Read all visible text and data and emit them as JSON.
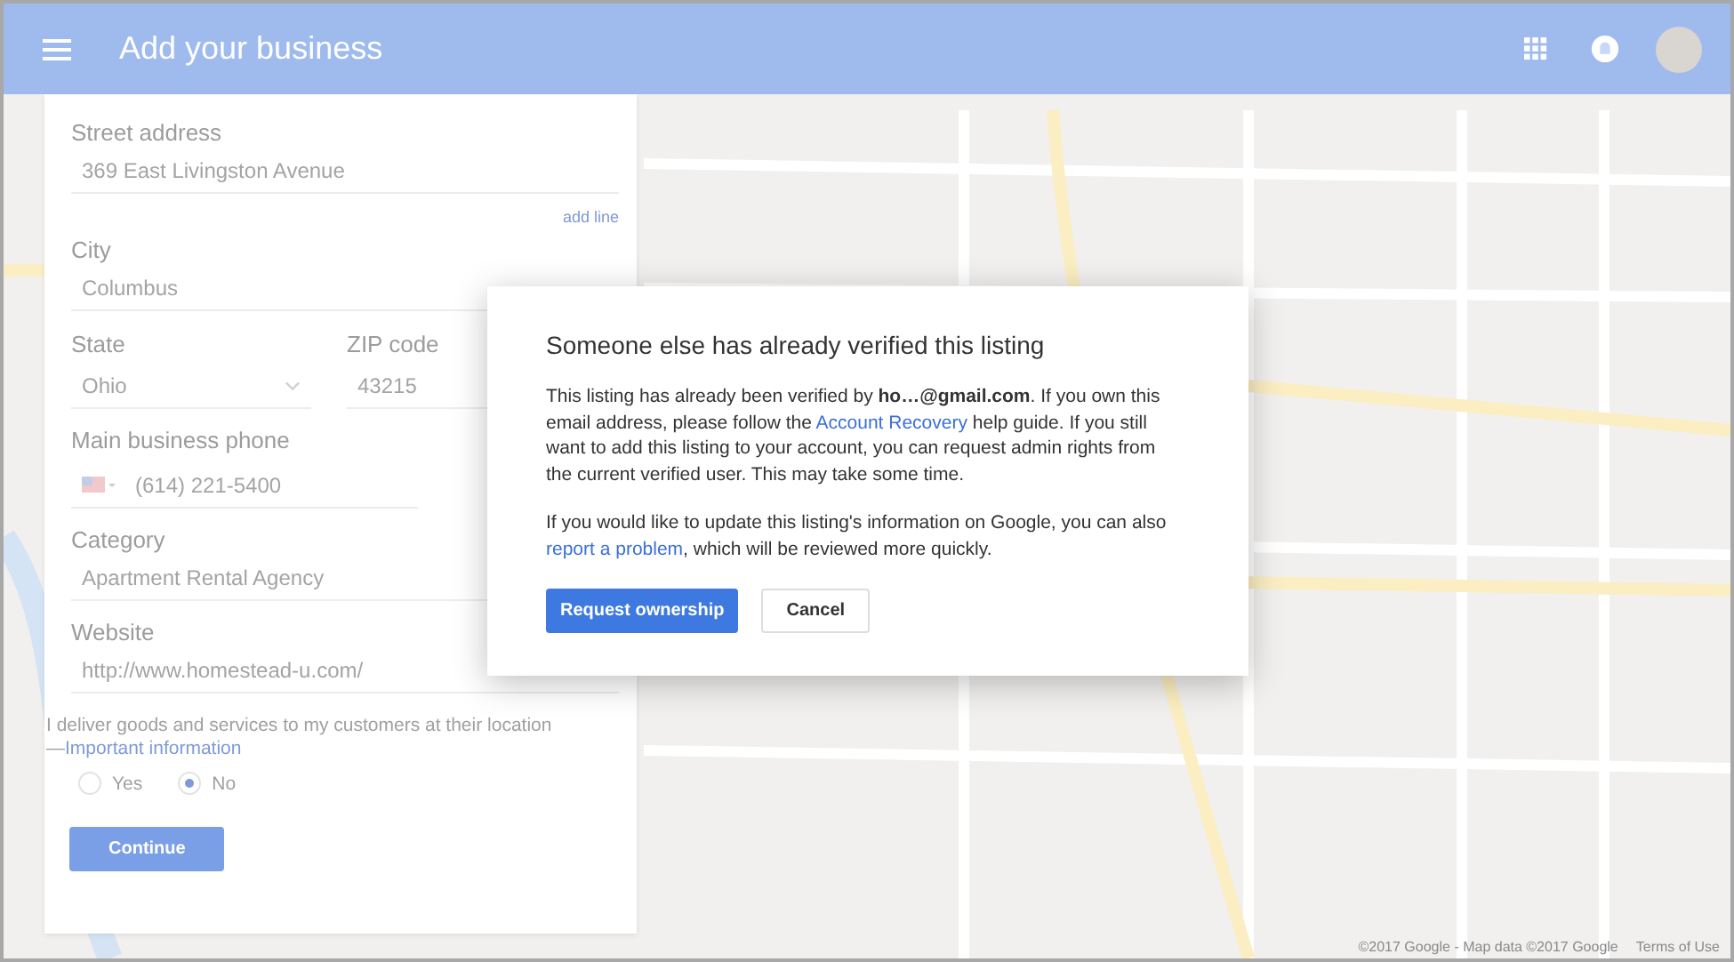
{
  "header": {
    "title": "Add your business"
  },
  "form": {
    "street": {
      "label": "Street address",
      "value": "369 East Livingston Avenue"
    },
    "add_line": "add line",
    "city": {
      "label": "City",
      "value": "Columbus"
    },
    "state": {
      "label": "State",
      "value": "Ohio"
    },
    "zip": {
      "label": "ZIP code",
      "value": "43215"
    },
    "phone": {
      "label": "Main business phone",
      "value": "(614) 221-5400"
    },
    "category": {
      "label": "Category",
      "value": "Apartment Rental Agency"
    },
    "website": {
      "label": "Website",
      "value": "http://www.homestead-u.com/"
    },
    "service_area": {
      "text": "I deliver goods and services to my customers at their location",
      "prefix": "—",
      "link": "Important information"
    },
    "options": [
      {
        "label": "Yes",
        "selected": false
      },
      {
        "label": "No",
        "selected": true
      }
    ],
    "continue": {
      "label": "Continue",
      "disabled": true
    }
  },
  "dialog": {
    "title": "Someone else has already verified this listing",
    "paragraphs": [
      [
        {
          "kind": "text",
          "text": "This listing has already been verified by **ho…@gmail.com**. If you own this email address, please follow the "
        },
        {
          "kind": "link",
          "text": "Account Recovery"
        },
        {
          "kind": "text",
          "text": " help guide. If you still want to add this listing to your account, you can request admin rights from the current verified user. This may take some time."
        }
      ],
      [
        {
          "kind": "text",
          "text": "If you would like to update this listing's information on Google, you can also "
        },
        {
          "kind": "link",
          "text": "report a problem"
        },
        {
          "kind": "text",
          "text": ", which will be reviewed more quickly."
        }
      ]
    ],
    "primary": "Request ownership",
    "secondary": "Cancel"
  },
  "map_footer": {
    "copyright": "©2017 Google - Map data ©2017 Google",
    "terms": "Terms of Use"
  }
}
